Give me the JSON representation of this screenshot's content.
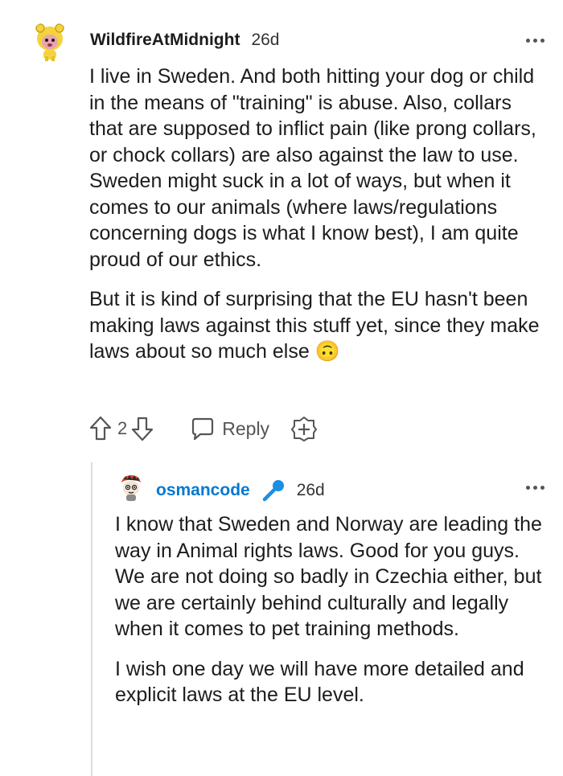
{
  "comments": [
    {
      "username": "WildfireAtMidnight",
      "time": "26d",
      "paragraphs": [
        "I live in Sweden. And both hitting your dog or child in the means of \"training\" is abuse. Also, collars that are supposed to inflict pain (like prong collars, or chock collars) are also against the law to use. Sweden might suck in a lot of ways, but when it comes to our animals (where laws/regulations concerning dogs is what I know best), I am quite proud of our ethics.",
        "But it is kind of surprising that the EU hasn't been making laws against this stuff yet, since they make laws about so much else 🙃"
      ],
      "vote_count": "2",
      "reply_label": "Reply"
    },
    {
      "username": "osmancode",
      "time": "26d",
      "paragraphs": [
        "I know that Sweden and Norway are leading the way in Animal rights laws. Good for you guys.\nWe are not doing so badly in Czechia either, but we are certainly behind culturally and legally when it comes to pet training methods.",
        "I wish one day we will have more detailed and explicit laws at the EU level."
      ]
    }
  ],
  "colors": {
    "op_blue": "#0079d3",
    "text": "#1c1c1c",
    "muted": "#555555"
  },
  "icons": [
    "dots-menu-icon",
    "upvote-icon",
    "downvote-icon",
    "reply-icon",
    "award-icon",
    "mic-icon"
  ]
}
